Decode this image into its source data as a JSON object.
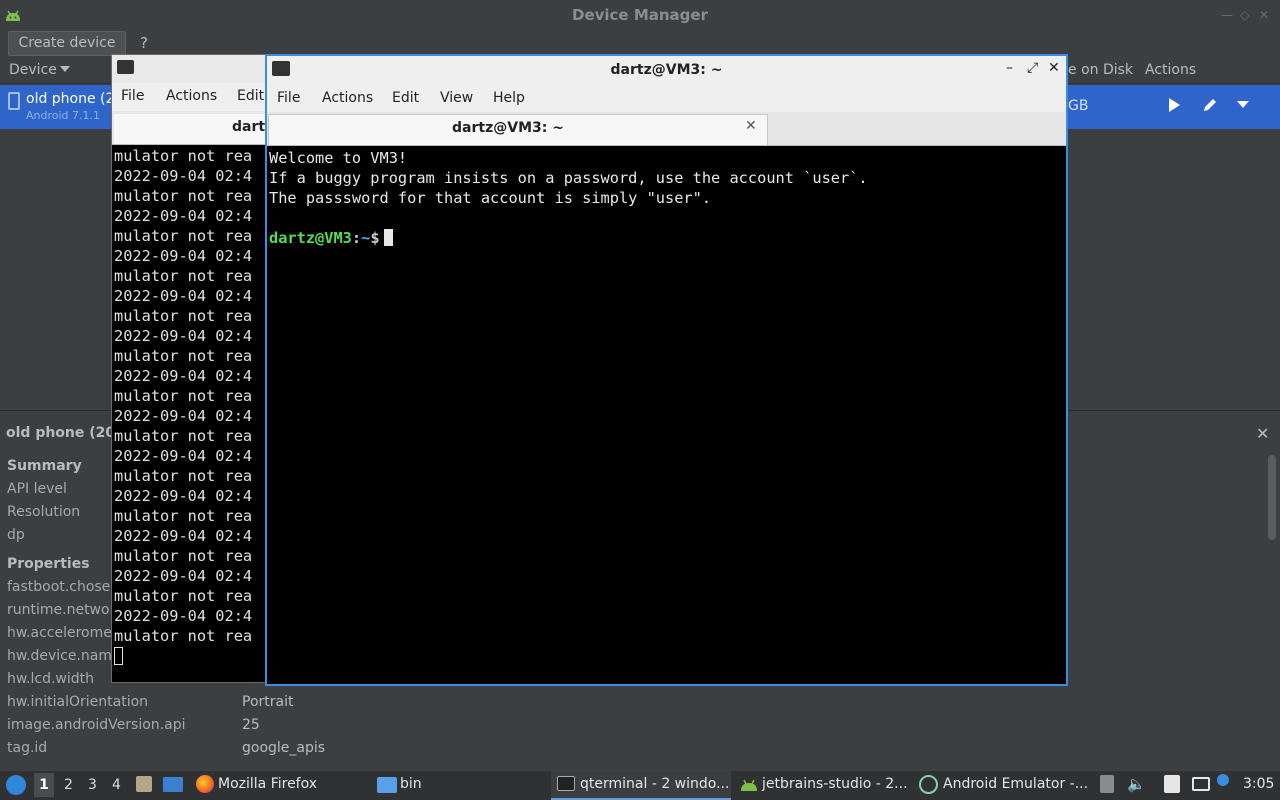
{
  "device_manager": {
    "title": "Device Manager",
    "create_device": "Create device",
    "help": "?",
    "columns": {
      "device": "Device",
      "size": "e on Disk",
      "actions": "Actions"
    },
    "device": {
      "name": "old phone (20",
      "sub": "Android 7.1.1",
      "size": "GB"
    },
    "details": {
      "title": "old phone (20",
      "summary_heading": "Summary",
      "summary": [
        "API level",
        "Resolution",
        "dp"
      ],
      "properties_heading": "Properties",
      "properties": [
        {
          "key": "fastboot.chosen",
          "value": ""
        },
        {
          "key": "runtime.network",
          "value": ""
        },
        {
          "key": "hw.acceleromet",
          "value": ""
        },
        {
          "key": "hw.device.name",
          "value": ""
        },
        {
          "key": "hw.lcd.width",
          "value": ""
        },
        {
          "key": "hw.initialOrientation",
          "value": "Portrait"
        },
        {
          "key": "image.androidVersion.api",
          "value": "25"
        },
        {
          "key": "tag.id",
          "value": "google_apis"
        }
      ]
    }
  },
  "back_terminal": {
    "menus": [
      "File",
      "Actions",
      "Edit"
    ],
    "tab_label": "dartz",
    "lines": [
      "mulator not rea",
      "2022-09-04 02:4",
      "mulator not rea",
      "2022-09-04 02:4",
      "mulator not rea",
      "2022-09-04 02:4",
      "mulator not rea",
      "2022-09-04 02:4",
      "mulator not rea",
      "2022-09-04 02:4",
      "mulator not rea",
      "2022-09-04 02:4",
      "mulator not rea",
      "2022-09-04 02:4",
      "mulator not rea",
      "2022-09-04 02:4",
      "mulator not rea",
      "2022-09-04 02:4",
      "mulator not rea",
      "2022-09-04 02:4",
      "mulator not rea",
      "2022-09-04 02:4",
      "mulator not rea",
      "2022-09-04 02:4",
      "mulator not rea"
    ]
  },
  "front_terminal": {
    "title": "dartz@VM3: ~",
    "menus": [
      "File",
      "Actions",
      "Edit",
      "View",
      "Help"
    ],
    "tab_label": "dartz@VM3: ~",
    "lines": [
      "Welcome to VM3!",
      "If a buggy program insists on a password, use the account `user`.",
      "The passsword for that account is simply \"user\"."
    ],
    "prompt": {
      "user_host": "dartz@VM3",
      "sep": ":",
      "dir": "~",
      "sym": "$"
    }
  },
  "taskbar": {
    "workspaces": [
      "1",
      "2",
      "3",
      "4"
    ],
    "tasks": {
      "firefox": "Mozilla Firefox",
      "folder": "bin",
      "qterminal": "qterminal - 2 windo...",
      "studio": "jetbrains-studio - 2...",
      "emulator": "Android Emulator -..."
    },
    "clock": "3:05"
  },
  "colors": {
    "accent_blue": "#2f65ca",
    "terminal_focus_border": "#3a8de0",
    "prompt_green": "#55dd55",
    "prompt_dir_blue": "#5aa8ff"
  }
}
